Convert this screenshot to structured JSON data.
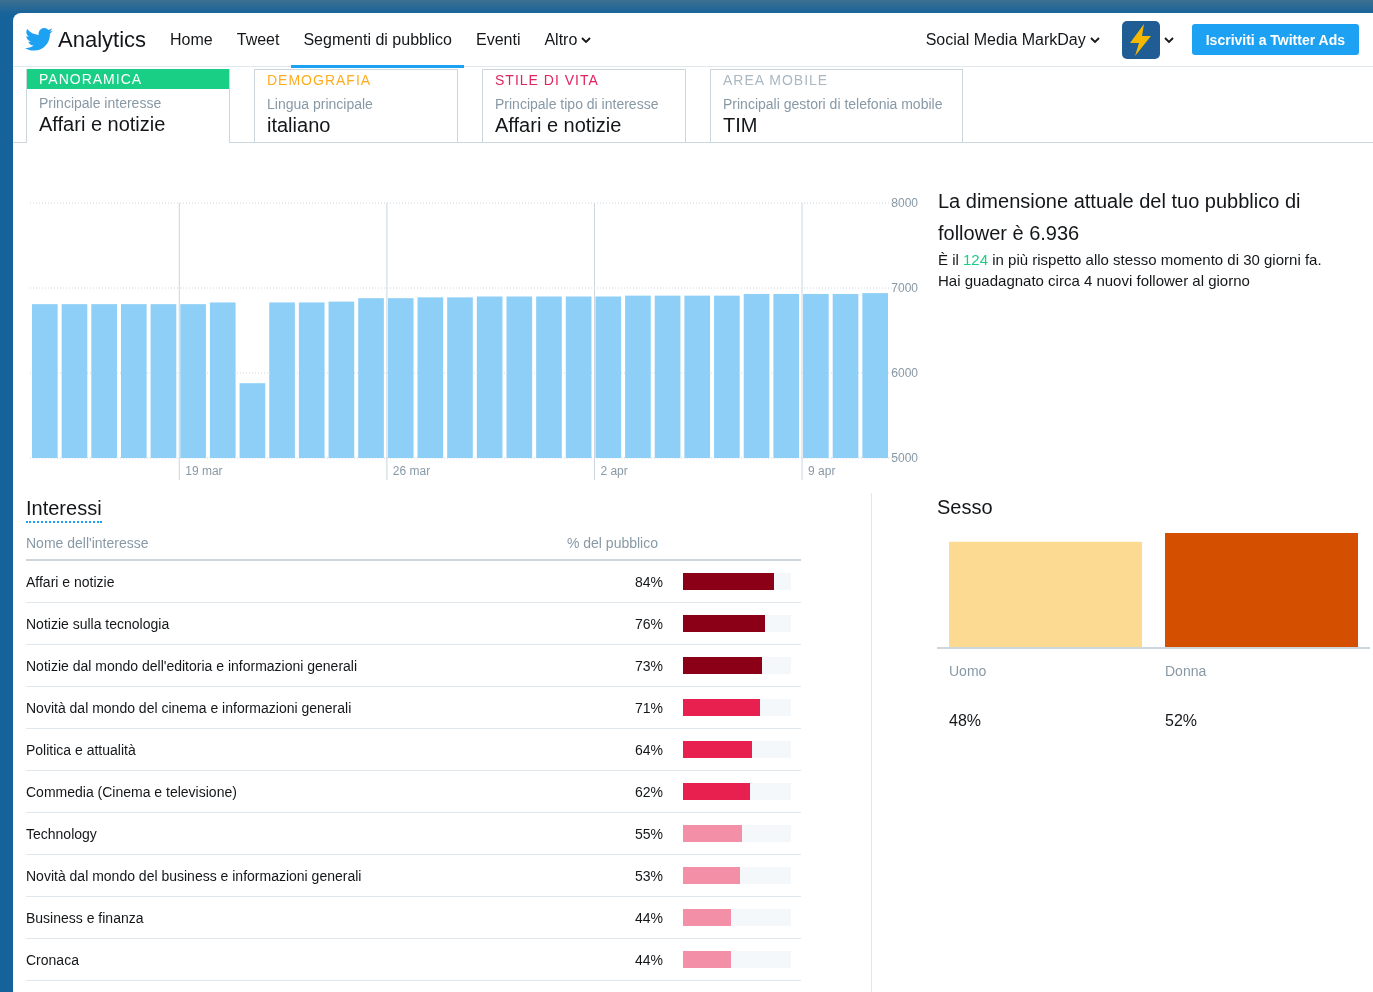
{
  "nav": {
    "brand": "Analytics",
    "items": [
      {
        "label": "Home",
        "selected": false,
        "dropdown": false
      },
      {
        "label": "Tweet",
        "selected": false,
        "dropdown": false
      },
      {
        "label": "Segmenti di pubblico",
        "selected": true,
        "dropdown": false
      },
      {
        "label": "Eventi",
        "selected": false,
        "dropdown": false
      },
      {
        "label": "Altro",
        "selected": false,
        "dropdown": true
      }
    ],
    "account": "Social Media MarkDay",
    "ads_button": "Iscriviti a Twitter Ads"
  },
  "cards": [
    {
      "title": "PANORAMICA",
      "color": "#19cf86",
      "selected": true,
      "subtitle": "Principale interesse",
      "value": "Affari e notizie"
    },
    {
      "title": "DEMOGRAFIA",
      "color": "#ffad1f",
      "selected": false,
      "subtitle": "Lingua principale",
      "value": "italiano"
    },
    {
      "title": "STILE DI VITA",
      "color": "#e0245e",
      "selected": false,
      "subtitle": "Principale tipo di interesse",
      "value": "Affari e notizie"
    },
    {
      "title": "AREA MOBILE",
      "color": "#aab8c2",
      "selected": false,
      "subtitle": "Principali gestori di telefonia mobile",
      "value": "TIM"
    }
  ],
  "followers": {
    "chart_data": {
      "type": "bar",
      "grid": true,
      "categories": [
        null,
        null,
        null,
        null,
        null,
        "19 mar",
        null,
        null,
        null,
        null,
        null,
        null,
        "26 mar",
        null,
        null,
        null,
        null,
        null,
        null,
        "2 apr",
        null,
        null,
        null,
        null,
        null,
        null,
        "9 apr",
        null,
        null
      ],
      "values": [
        6810,
        6810,
        6810,
        6810,
        6810,
        6810,
        6830,
        5880,
        6830,
        6830,
        6840,
        6880,
        6880,
        6890,
        6890,
        6900,
        6900,
        6900,
        6900,
        6900,
        6910,
        6910,
        6910,
        6910,
        6930,
        6930,
        6930,
        6930,
        6940
      ],
      "ylim": [
        5000,
        8000
      ],
      "yticks": [
        5000,
        6000,
        7000,
        8000
      ]
    },
    "headline": "La dimensione attuale del tuo pubblico di follower è 6.936",
    "detail": {
      "prefix": "È il ",
      "highlight": "124",
      "suffix": " in più rispetto allo stesso momento di 30 giorni fa. Hai guadagnato circa 4 nuovi follower al giorno"
    }
  },
  "interests": {
    "title": "Interessi",
    "columns": [
      "Nome dell'interesse",
      "% del pubblico"
    ],
    "rows": [
      {
        "name": "Affari e notizie",
        "pct": "84%",
        "level": 0.84,
        "color": "#8b0016"
      },
      {
        "name": "Notizie sulla tecnologia",
        "pct": "76%",
        "level": 0.76,
        "color": "#8b0016"
      },
      {
        "name": "Notizie dal mondo dell'editoria e informazioni generali",
        "pct": "73%",
        "level": 0.73,
        "color": "#8b0016"
      },
      {
        "name": "Novità dal mondo del cinema e informazioni generali",
        "pct": "71%",
        "level": 0.71,
        "color": "#e8204f"
      },
      {
        "name": "Politica e attualità",
        "pct": "64%",
        "level": 0.64,
        "color": "#e8204f"
      },
      {
        "name": "Commedia (Cinema e televisione)",
        "pct": "62%",
        "level": 0.62,
        "color": "#e8204f"
      },
      {
        "name": "Technology",
        "pct": "55%",
        "level": 0.55,
        "color": "#f38fa6"
      },
      {
        "name": "Novità dal mondo del business e informazioni generali",
        "pct": "53%",
        "level": 0.53,
        "color": "#f38fa6"
      },
      {
        "name": "Business e finanza",
        "pct": "44%",
        "level": 0.44,
        "color": "#f38fa6"
      },
      {
        "name": "Cronaca",
        "pct": "44%",
        "level": 0.44,
        "color": "#f38fa6"
      }
    ]
  },
  "gender": {
    "title": "Sesso",
    "chart_data": {
      "type": "bar",
      "categories": [
        "Uomo",
        "Donna"
      ],
      "values": [
        48,
        52
      ],
      "value_labels": [
        "48%",
        "52%"
      ]
    },
    "items": [
      {
        "color": "#fcda92"
      },
      {
        "color": "#d54f00"
      }
    ]
  }
}
